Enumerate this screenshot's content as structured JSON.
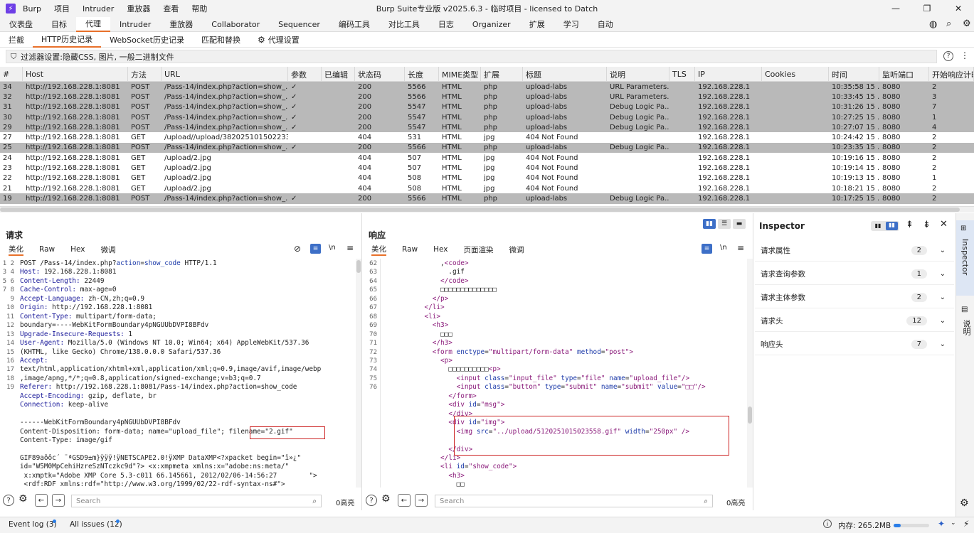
{
  "titlebar": {
    "menus": [
      "Burp",
      "项目",
      "Intruder",
      "重放器",
      "查看",
      "帮助"
    ],
    "title": "Burp Suite专业版  v2025.6.3 - 临时项目 - licensed to Datch"
  },
  "main_tabs": [
    "仪表盘",
    "目标",
    "代理",
    "Intruder",
    "重放器",
    "Collaborator",
    "Sequencer",
    "编码工具",
    "对比工具",
    "日志",
    "Organizer",
    "扩展",
    "学习",
    "自动"
  ],
  "sub_tabs": [
    "拦截",
    "HTTP历史记录",
    "WebSocket历史记录",
    "匹配和替换",
    "代理设置"
  ],
  "filter": {
    "text": "过滤器设置:隐藏CSS, 图片, 一般二进制文件"
  },
  "table": {
    "columns": [
      "#",
      "Host",
      "方法",
      "URL",
      "参数",
      "已编辑",
      "状态码",
      "长度",
      "MIME类型",
      "扩展",
      "标题",
      "说明",
      "TLS",
      "IP",
      "Cookies",
      "时间",
      "监听端口",
      "开始响应计时"
    ],
    "rows": [
      {
        "id": "34",
        "host": "http://192.168.228.1:8081",
        "method": "POST",
        "url": "/Pass-14/index.php?action=show_...",
        "params": "✓",
        "status": "200",
        "length": "5566",
        "mime": "HTML",
        "ext": "php",
        "title": "upload-labs",
        "note": "URL Parameters...",
        "ip": "192.168.228.1",
        "time": "10:35:58 15 ...",
        "port": "8080",
        "resp": "2",
        "hl": true
      },
      {
        "id": "32",
        "host": "http://192.168.228.1:8081",
        "method": "POST",
        "url": "/Pass-14/index.php?action=show_...",
        "params": "✓",
        "status": "200",
        "length": "5566",
        "mime": "HTML",
        "ext": "php",
        "title": "upload-labs",
        "note": "URL Parameters...",
        "ip": "192.168.228.1",
        "time": "10:33:45 15 ...",
        "port": "8080",
        "resp": "3",
        "hl": true
      },
      {
        "id": "31",
        "host": "http://192.168.228.1:8081",
        "method": "POST",
        "url": "/Pass-14/index.php?action=show_...",
        "params": "✓",
        "status": "200",
        "length": "5547",
        "mime": "HTML",
        "ext": "php",
        "title": "upload-labs",
        "note": "Debug Logic Pa...",
        "ip": "192.168.228.1",
        "time": "10:31:26 15 ...",
        "port": "8080",
        "resp": "7",
        "hl": true
      },
      {
        "id": "30",
        "host": "http://192.168.228.1:8081",
        "method": "POST",
        "url": "/Pass-14/index.php?action=show_...",
        "params": "✓",
        "status": "200",
        "length": "5547",
        "mime": "HTML",
        "ext": "php",
        "title": "upload-labs",
        "note": "Debug Logic Pa...",
        "ip": "192.168.228.1",
        "time": "10:27:25 15 ...",
        "port": "8080",
        "resp": "1",
        "hl": true
      },
      {
        "id": "29",
        "host": "http://192.168.228.1:8081",
        "method": "POST",
        "url": "/Pass-14/index.php?action=show_...",
        "params": "✓",
        "status": "200",
        "length": "5547",
        "mime": "HTML",
        "ext": "php",
        "title": "upload-labs",
        "note": "Debug Logic Pa...",
        "ip": "192.168.228.1",
        "time": "10:27:07 15 ...",
        "port": "8080",
        "resp": "4",
        "hl": true
      },
      {
        "id": "27",
        "host": "http://192.168.228.1:8081",
        "method": "GET",
        "url": "/upload//upload/382025101502233...",
        "params": "",
        "status": "404",
        "length": "531",
        "mime": "HTML",
        "ext": "jpg",
        "title": "404 Not Found",
        "note": "",
        "ip": "192.168.228.1",
        "time": "10:24:42 15 ...",
        "port": "8080",
        "resp": "2",
        "hl": false
      },
      {
        "id": "25",
        "host": "http://192.168.228.1:8081",
        "method": "POST",
        "url": "/Pass-14/index.php?action=show_...",
        "params": "✓",
        "status": "200",
        "length": "5566",
        "mime": "HTML",
        "ext": "php",
        "title": "upload-labs",
        "note": "Debug Logic Pa...",
        "ip": "192.168.228.1",
        "time": "10:23:35 15 ...",
        "port": "8080",
        "resp": "2",
        "hl": true
      },
      {
        "id": "24",
        "host": "http://192.168.228.1:8081",
        "method": "GET",
        "url": "/upload/2.jpg",
        "params": "",
        "status": "404",
        "length": "507",
        "mime": "HTML",
        "ext": "jpg",
        "title": "404 Not Found",
        "note": "",
        "ip": "192.168.228.1",
        "time": "10:19:16 15 ...",
        "port": "8080",
        "resp": "2",
        "hl": false
      },
      {
        "id": "23",
        "host": "http://192.168.228.1:8081",
        "method": "GET",
        "url": "/upload/2.jpg",
        "params": "",
        "status": "404",
        "length": "507",
        "mime": "HTML",
        "ext": "jpg",
        "title": "404 Not Found",
        "note": "",
        "ip": "192.168.228.1",
        "time": "10:19:14 15 ...",
        "port": "8080",
        "resp": "2",
        "hl": false
      },
      {
        "id": "22",
        "host": "http://192.168.228.1:8081",
        "method": "GET",
        "url": "/upload/2.jpg",
        "params": "",
        "status": "404",
        "length": "508",
        "mime": "HTML",
        "ext": "jpg",
        "title": "404 Not Found",
        "note": "",
        "ip": "192.168.228.1",
        "time": "10:19:13 15 ...",
        "port": "8080",
        "resp": "1",
        "hl": false
      },
      {
        "id": "21",
        "host": "http://192.168.228.1:8081",
        "method": "GET",
        "url": "/upload/2.jpg",
        "params": "",
        "status": "404",
        "length": "508",
        "mime": "HTML",
        "ext": "jpg",
        "title": "404 Not Found",
        "note": "",
        "ip": "192.168.228.1",
        "time": "10:18:21 15 ...",
        "port": "8080",
        "resp": "2",
        "hl": false
      },
      {
        "id": "19",
        "host": "http://192.168.228.1:8081",
        "method": "POST",
        "url": "/Pass-14/index.php?action=show_...",
        "params": "✓",
        "status": "200",
        "length": "5566",
        "mime": "HTML",
        "ext": "php",
        "title": "upload-labs",
        "note": "Debug Logic Pa...",
        "ip": "192.168.228.1",
        "time": "10:17:25 15 ...",
        "port": "8080",
        "resp": "2",
        "hl": true
      }
    ]
  },
  "request": {
    "title": "请求",
    "tabs": [
      "美化",
      "Raw",
      "Hex",
      "微调"
    ],
    "search_placeholder": "Search",
    "highlights": "0高亮"
  },
  "response": {
    "title": "响应",
    "tabs": [
      "美化",
      "Raw",
      "Hex",
      "页面渲染",
      "微调"
    ],
    "search_placeholder": "Search",
    "highlights": "0高亮"
  },
  "inspector": {
    "title": "Inspector",
    "sections": [
      {
        "label": "请求属性",
        "count": "2"
      },
      {
        "label": "请求查询参数",
        "count": "1"
      },
      {
        "label": "请求主体参数",
        "count": "2"
      },
      {
        "label": "请求头",
        "count": "12"
      },
      {
        "label": "响应头",
        "count": "7"
      }
    ],
    "side_tabs": [
      "Inspector",
      "说明"
    ]
  },
  "statusbar": {
    "event_log": "Event log (3)",
    "all_issues": "All issues (12)",
    "memory": "内存: 265.2MB"
  }
}
